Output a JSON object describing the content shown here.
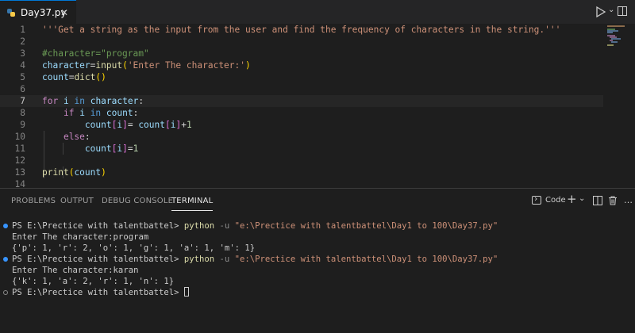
{
  "tab": {
    "filename": "Day37.py",
    "close": "✕"
  },
  "editor": {
    "lines": [
      {
        "n": "1",
        "tokens": [
          [
            "str",
            "'''Get a string as the input from the user and find the frequency of characters in the string.'''"
          ]
        ]
      },
      {
        "n": "2",
        "tokens": []
      },
      {
        "n": "3",
        "tokens": [
          [
            "cmt",
            "#character=\"program\""
          ]
        ]
      },
      {
        "n": "4",
        "tokens": [
          [
            "var",
            "character"
          ],
          [
            "op",
            "="
          ],
          [
            "fn",
            "input"
          ],
          [
            "br",
            "("
          ],
          [
            "str",
            "'Enter The character:'"
          ],
          [
            "br",
            ")"
          ]
        ]
      },
      {
        "n": "5",
        "tokens": [
          [
            "var",
            "count"
          ],
          [
            "op",
            "="
          ],
          [
            "fn",
            "dict"
          ],
          [
            "br",
            "()"
          ]
        ]
      },
      {
        "n": "6",
        "tokens": []
      },
      {
        "n": "7",
        "tokens": [
          [
            "kw",
            "for"
          ],
          [
            "op",
            " "
          ],
          [
            "var",
            "i"
          ],
          [
            "op",
            " "
          ],
          [
            "kwb",
            "in"
          ],
          [
            "op",
            " "
          ],
          [
            "var",
            "character"
          ],
          [
            "op",
            ":"
          ]
        ]
      },
      {
        "n": "8",
        "tokens": [
          [
            "op",
            "    "
          ],
          [
            "kw",
            "if"
          ],
          [
            "op",
            " "
          ],
          [
            "var",
            "i"
          ],
          [
            "op",
            " "
          ],
          [
            "kwb",
            "in"
          ],
          [
            "op",
            " "
          ],
          [
            "var",
            "count"
          ],
          [
            "op",
            ":"
          ]
        ]
      },
      {
        "n": "9",
        "tokens": [
          [
            "op",
            "        "
          ],
          [
            "var",
            "count"
          ],
          [
            "br2",
            "["
          ],
          [
            "var",
            "i"
          ],
          [
            "br2",
            "]"
          ],
          [
            "op",
            "= "
          ],
          [
            "var",
            "count"
          ],
          [
            "br2",
            "["
          ],
          [
            "var",
            "i"
          ],
          [
            "br2",
            "]"
          ],
          [
            "op",
            "+"
          ],
          [
            "num",
            "1"
          ]
        ]
      },
      {
        "n": "10",
        "tokens": [
          [
            "op",
            "    "
          ],
          [
            "kw",
            "else"
          ],
          [
            "op",
            ":"
          ]
        ]
      },
      {
        "n": "11",
        "tokens": [
          [
            "op",
            "        "
          ],
          [
            "var",
            "count"
          ],
          [
            "br2",
            "["
          ],
          [
            "var",
            "i"
          ],
          [
            "br2",
            "]"
          ],
          [
            "op",
            "="
          ],
          [
            "num",
            "1"
          ]
        ]
      },
      {
        "n": "12",
        "tokens": []
      },
      {
        "n": "13",
        "tokens": [
          [
            "fn",
            "print"
          ],
          [
            "br",
            "("
          ],
          [
            "var",
            "count"
          ],
          [
            "br",
            ")"
          ]
        ]
      },
      {
        "n": "14",
        "tokens": []
      }
    ],
    "active_line": 7
  },
  "panel": {
    "tabs": [
      "PROBLEMS",
      "OUTPUT",
      "DEBUG CONSOLE",
      "TERMINAL"
    ],
    "active_tab": "TERMINAL",
    "terminal_profile": "Code"
  },
  "terminal": {
    "prompt": "PS E:\\Prectice with talentbattel> ",
    "command": "python",
    "flag": " -u ",
    "script_path": "\"e:\\Prectice with talentbattel\\Day1 to 100\\Day37.py\"",
    "output1_input": "Enter The character:program",
    "output1_result": "{'p': 1, 'r': 2, 'o': 1, 'g': 1, 'a': 1, 'm': 1}",
    "output2_input": "Enter The character:karan",
    "output2_result": "{'k': 1, 'a': 2, 'r': 1, 'n': 1}"
  }
}
